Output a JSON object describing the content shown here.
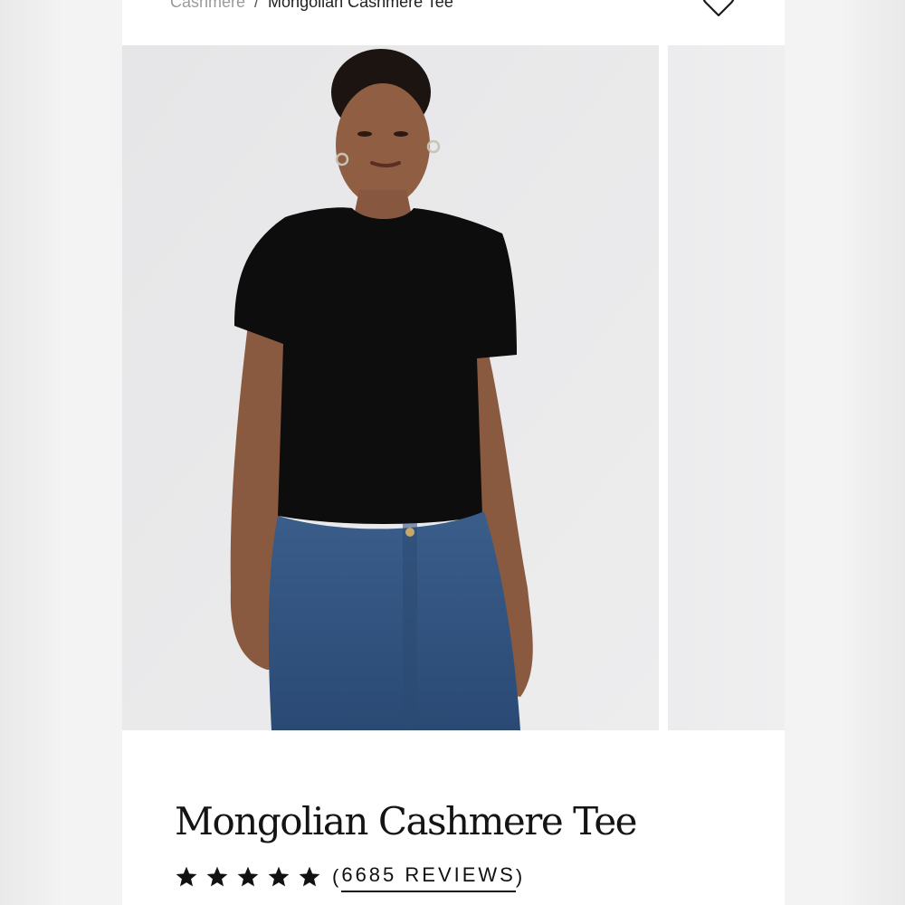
{
  "breadcrumb": {
    "previous": "Cashmere",
    "separator": "/",
    "current": "Mongolian Cashmere Tee"
  },
  "wishlist_icon": "heart-icon",
  "gallery": {
    "main_image": "model-black-cashmere-tee-blue-jeans",
    "next_image": "product-image-partial"
  },
  "product": {
    "title": "Mongolian Cashmere Tee",
    "rating": {
      "stars": 5,
      "max_stars": 5,
      "open_paren": "(",
      "reviews_label": "6685 REVIEWS",
      "close_paren": ")"
    }
  },
  "colors": {
    "shirt": "#0d0d0d",
    "denim": "#2e4f7a",
    "background": "#e9e9eb",
    "skin": "#8f5e43"
  }
}
